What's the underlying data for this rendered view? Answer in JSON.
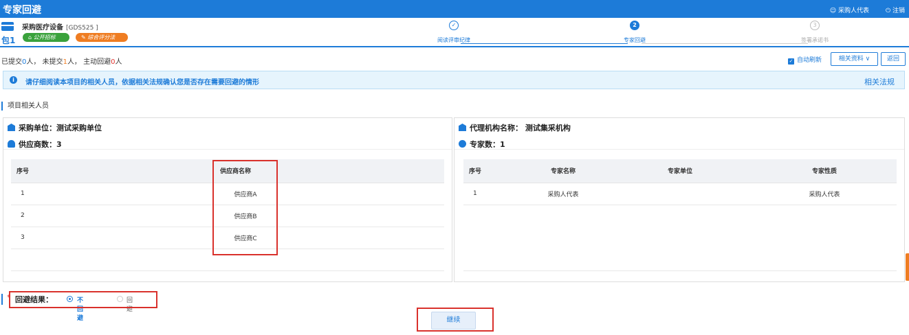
{
  "header": {
    "title": "专家回避",
    "user": "采购人代表",
    "logout": "注销"
  },
  "package": {
    "name": "采购医疗设备",
    "code": "[GDS525 ]",
    "number": "包1",
    "badges": [
      "公开招标",
      "综合评分法"
    ]
  },
  "steps": [
    {
      "num": "✓",
      "label": "阅读评审纪律"
    },
    {
      "num": "2",
      "label": "专家回避"
    },
    {
      "num": "3",
      "label": "签署承诺书"
    }
  ],
  "stats": {
    "submitted_prefix": "已提交",
    "submitted": "0",
    "not_submitted_prefix": "人， 未提交",
    "not_submitted": "1",
    "avoid_prefix": "人， 主动回避",
    "avoid": "0",
    "suffix": "人"
  },
  "toolbar": {
    "auto_refresh": "自动刷新",
    "related_docs": "相关资料 ∨",
    "back": "返回"
  },
  "notice": {
    "text": "请仔细阅读本项目的相关人员，依据相关法规确认您是否存在需要回避的情形",
    "link": "相关法规"
  },
  "section_title": "项目相关人员",
  "left_panel": {
    "purchaser": "采购单位：测试采购单位",
    "supplier_count": "供应商数：3",
    "columns": [
      "序号",
      "供应商名称"
    ],
    "rows": [
      [
        "1",
        "供应商A"
      ],
      [
        "2",
        "供应商B"
      ],
      [
        "3",
        "供应商C"
      ]
    ]
  },
  "right_panel": {
    "agency": "代理机构名称： 测试集采机构",
    "expert_count": "专家数：1",
    "columns": [
      "序号",
      "专家名称",
      "专家单位",
      "专家性质"
    ],
    "rows": [
      [
        "1",
        "采购人代表",
        "",
        "采购人代表"
      ]
    ]
  },
  "result": {
    "star": "*",
    "label": "回避结果：",
    "option_no": "不回避",
    "option_yes": "回避"
  },
  "continue_label": "继续",
  "colors": {
    "primary": "#1d7bd8",
    "green": "#3aa23c",
    "orange": "#ef7d22",
    "highlight_red": "#d9302b"
  }
}
